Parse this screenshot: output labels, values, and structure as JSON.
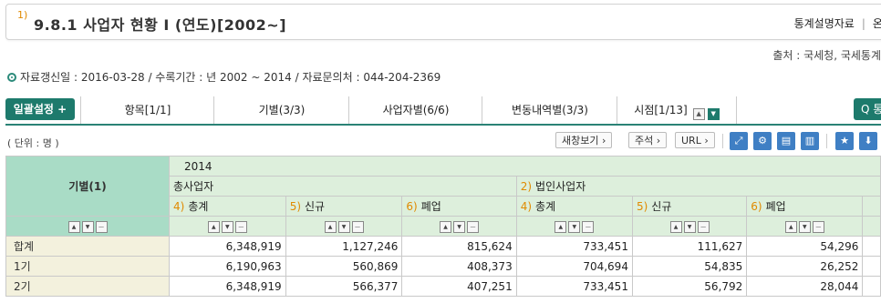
{
  "header": {
    "superscript": "1)",
    "title": "9.8.1 사업자 현황 I (연도)[2002~]",
    "link_stats_desc": "통계설명자료",
    "link_online": "온라인"
  },
  "source": "출처 : 국세청, 국세통계",
  "info": {
    "updated_label": "자료갱신일 : ",
    "updated": "2016-03-28",
    "period_label": "수록기간 : ",
    "period": "년 2002 ~ 2014",
    "contact_label": "자료문의처 : ",
    "contact": "044-204-2369"
  },
  "tabs": {
    "batch_label": "일괄설정 +",
    "items": [
      "항목[1/1]",
      "기별(3/3)",
      "사업자별(6/6)",
      "변동내역별(3/3)",
      "시점[1/13]"
    ],
    "search_label": "Q 통"
  },
  "unit": "( 단위 : 명 )",
  "toolbar": {
    "new_window": "새창보기 ›",
    "annotation": "주석 ›",
    "url": "URL ›"
  },
  "table": {
    "row_header_title": "기별(1)",
    "year": "2014",
    "group1": {
      "num": "",
      "label": "총사업자"
    },
    "group2": {
      "num": "2)",
      "label": "법인사업자"
    },
    "columns": [
      {
        "num": "4)",
        "label": "총계"
      },
      {
        "num": "5)",
        "label": "신규"
      },
      {
        "num": "6)",
        "label": "폐업"
      },
      {
        "num": "4)",
        "label": "총계"
      },
      {
        "num": "5)",
        "label": "신규"
      },
      {
        "num": "6)",
        "label": "폐업"
      }
    ],
    "rows": [
      {
        "label": "합계",
        "values": [
          "6,348,919",
          "1,127,246",
          "815,624",
          "733,451",
          "111,627",
          "54,296"
        ]
      },
      {
        "label": "1기",
        "values": [
          "6,190,963",
          "560,869",
          "408,373",
          "704,694",
          "54,835",
          "26,252"
        ]
      },
      {
        "label": "2기",
        "values": [
          "6,348,919",
          "566,377",
          "407,251",
          "733,451",
          "56,792",
          "28,044"
        ]
      }
    ]
  }
}
